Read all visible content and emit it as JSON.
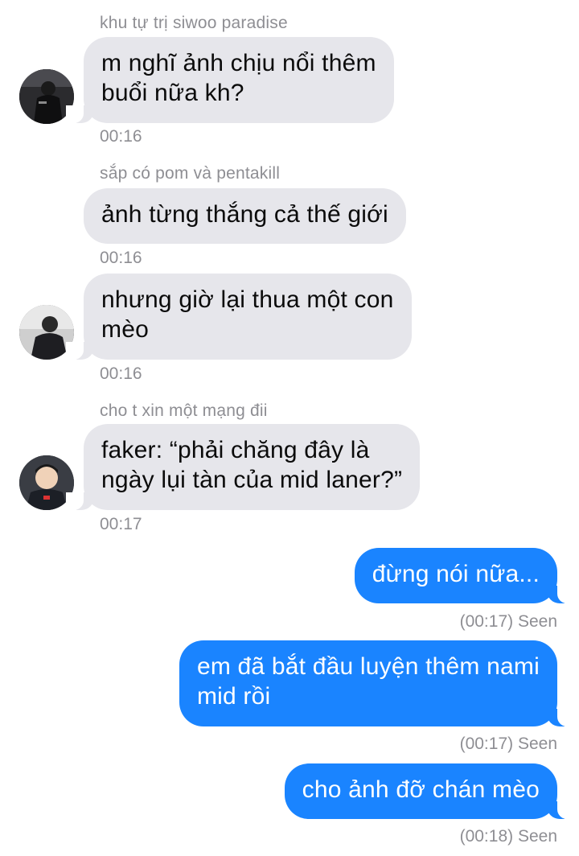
{
  "colors": {
    "incoming_bubble": "#e6e6eb",
    "outgoing_bubble": "#1a84ff",
    "meta_text": "#8e8e93"
  },
  "messages": [
    {
      "sender": "khu tự trị siwoo paradise",
      "lines": [
        "m nghĩ ảnh chịu nổi thêm",
        "buổi nữa kh?"
      ],
      "time": "00:16",
      "avatar": "avatar-dark-jacket-photo"
    },
    {
      "sender": "sắp có pom và pentakill",
      "lines": [
        "ảnh từng thắng cả thế giới"
      ],
      "time": "00:16"
    },
    {
      "lines": [
        "nhưng giờ lại thua một con",
        "mèo"
      ],
      "time": "00:16",
      "avatar": "avatar-suit-photo"
    },
    {
      "sender": "cho t xin một mạng đii",
      "lines": [
        "faker: “phải chăng đây là",
        "ngày lụi tàn của mid laner?”"
      ],
      "time": "00:17",
      "avatar": "avatar-smiling-player-photo"
    },
    {
      "lines": [
        "đừng nói nữa..."
      ],
      "status": "(00:17) Seen"
    },
    {
      "lines": [
        "em đã bắt đầu luyện thêm nami",
        "mid rồi"
      ],
      "status": "(00:17) Seen"
    },
    {
      "lines": [
        "cho ảnh đỡ chán mèo"
      ],
      "status": "(00:18) Seen"
    }
  ]
}
